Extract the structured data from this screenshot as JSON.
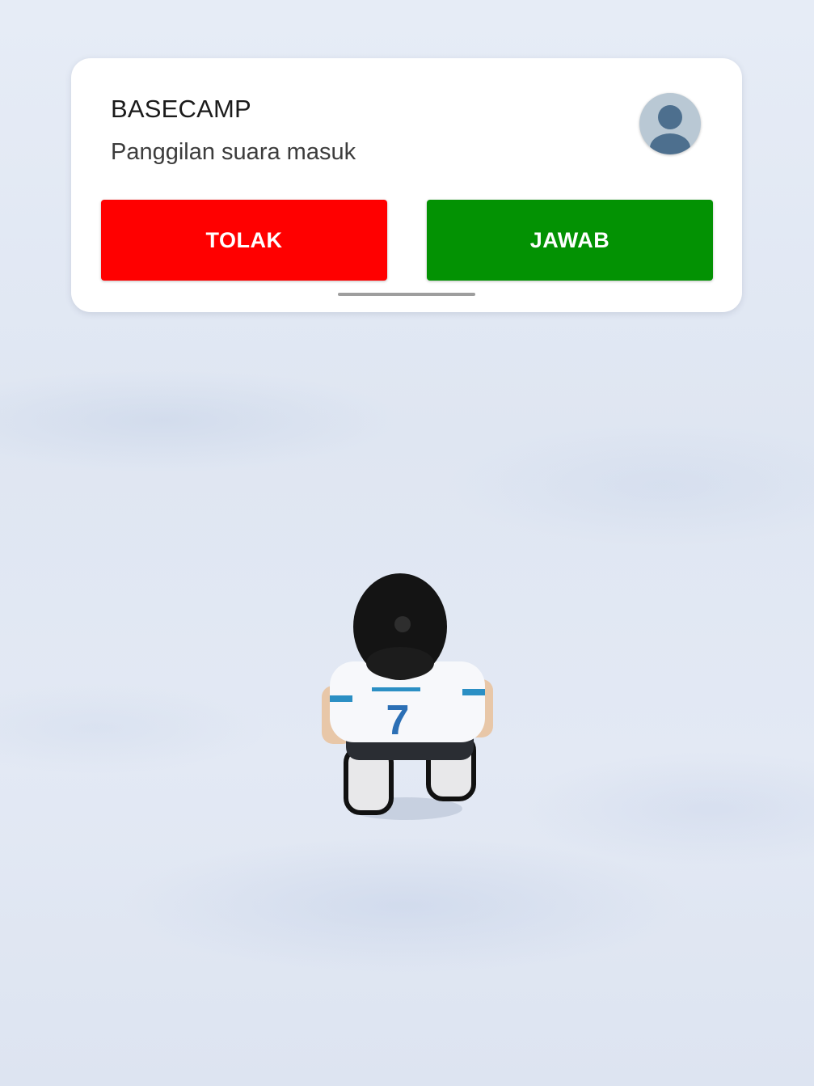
{
  "notification": {
    "caller_name": "BASECAMP",
    "subtitle": "Panggilan suara masuk",
    "avatar_icon": "person-icon",
    "decline_label": "TOLAK",
    "answer_label": "JAWAB",
    "colors": {
      "decline": "#ff0000",
      "answer": "#039203",
      "card_background": "#ffffff"
    }
  },
  "scene": {
    "background_color": "#e2e8f3",
    "character": {
      "jersey_number": "7"
    }
  }
}
